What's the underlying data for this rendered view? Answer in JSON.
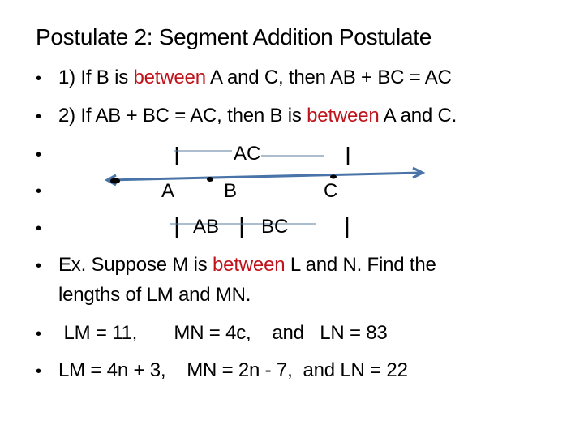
{
  "title": "Postulate 2:  Segment Addition Postulate",
  "bullets": [
    {
      "parts": [
        {
          "text": "1)  If B is ",
          "color": "black"
        },
        {
          "text": "between",
          "color": "red"
        },
        {
          "text": " A and C, then AB + BC = AC",
          "color": "black"
        }
      ]
    },
    {
      "parts": [
        {
          "text": "2)  If AB + BC = AC, then B is ",
          "color": "black"
        },
        {
          "text": "between",
          "color": "red"
        },
        {
          "text": " A and C.",
          "color": "black"
        }
      ]
    },
    {
      "parts": [
        {
          "text": "Ex.  Suppose M is ",
          "color": "black"
        },
        {
          "text": "between",
          "color": "red"
        },
        {
          "text": " L and N.  Find the",
          "color": "black"
        }
      ],
      "continuation": "lengths of LM and MN."
    },
    {
      "text": " LM = 11,       MN = 4c,    and   LN = 83"
    },
    {
      "text": "LM = 4n + 3,    MN = 2n - 7,  and LN = 22"
    }
  ],
  "diagram": {
    "points": [
      "A",
      "B",
      "C"
    ],
    "segment_top_label": "AC",
    "segment_bottom_labels": [
      "AB",
      "BC"
    ],
    "bar_glyph": "|"
  },
  "colors": {
    "highlight": "#c0141c",
    "line": "#4a74a8",
    "text": "#000000"
  }
}
